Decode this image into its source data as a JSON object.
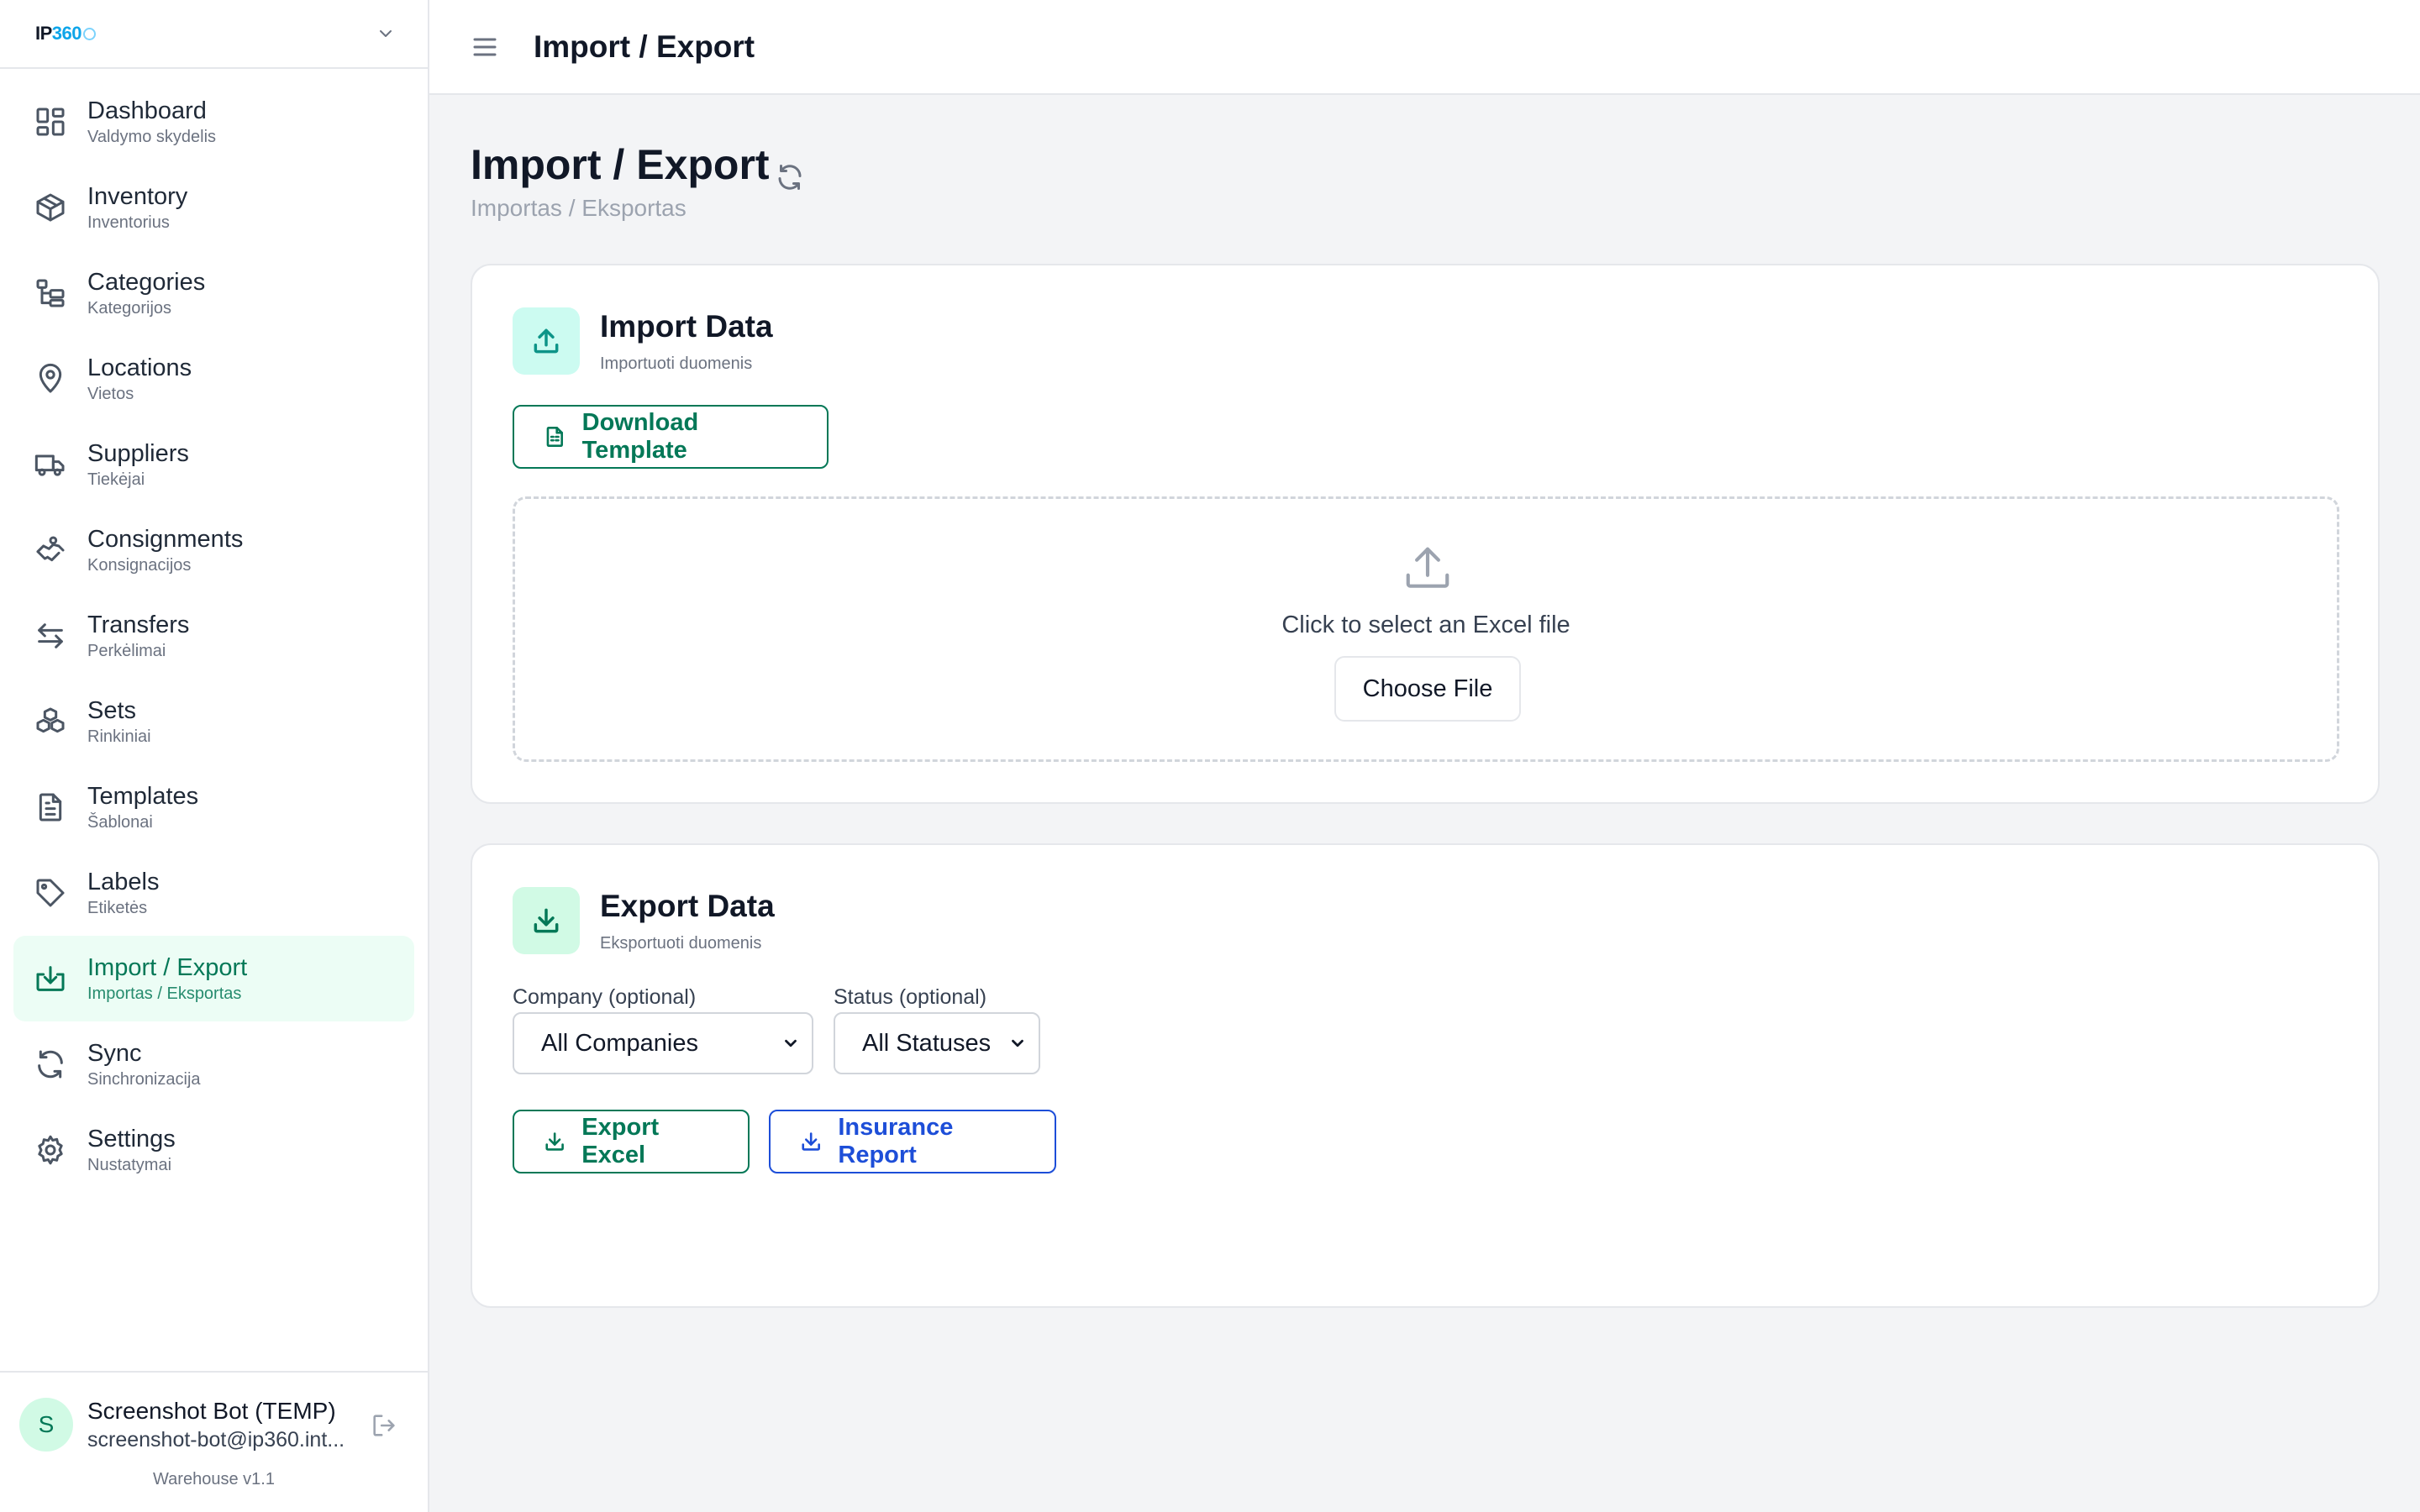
{
  "brand": {
    "logo_text_a": "IP",
    "logo_text_b": "360"
  },
  "sidebar": {
    "items": [
      {
        "label": "Dashboard",
        "sub": "Valdymo skydelis",
        "icon": "dashboard-grid-icon"
      },
      {
        "label": "Inventory",
        "sub": "Inventorius",
        "icon": "box-icon"
      },
      {
        "label": "Categories",
        "sub": "Kategorijos",
        "icon": "hierarchy-icon"
      },
      {
        "label": "Locations",
        "sub": "Vietos",
        "icon": "map-pin-icon"
      },
      {
        "label": "Suppliers",
        "sub": "Tiekėjai",
        "icon": "truck-icon"
      },
      {
        "label": "Consignments",
        "sub": "Konsignacijos",
        "icon": "handshake-icon"
      },
      {
        "label": "Transfers",
        "sub": "Perkėlimai",
        "icon": "arrows-left-right-icon"
      },
      {
        "label": "Sets",
        "sub": "Rinkiniai",
        "icon": "boxes-icon"
      },
      {
        "label": "Templates",
        "sub": "Šablonai",
        "icon": "document-icon"
      },
      {
        "label": "Labels",
        "sub": "Etiketės",
        "icon": "tag-icon"
      },
      {
        "label": "Import / Export",
        "sub": "Importas / Eksportas",
        "icon": "import-export-icon",
        "active": true
      },
      {
        "label": "Sync",
        "sub": "Sinchronizacija",
        "icon": "sync-icon"
      },
      {
        "label": "Settings",
        "sub": "Nustatymai",
        "icon": "gear-icon"
      }
    ]
  },
  "user": {
    "initial": "S",
    "name": "Screenshot Bot (TEMP)",
    "email": "screenshot-bot@ip360.int...",
    "version": "Warehouse v1.1"
  },
  "topbar": {
    "title": "Import / Export"
  },
  "page": {
    "title": "Import / Export",
    "subtitle": "Importas / Eksportas"
  },
  "import_card": {
    "title": "Import Data",
    "subtitle": "Importuoti duomenis",
    "download_template_label": "Download Template",
    "dropzone_text": "Click to select an Excel file",
    "choose_file_label": "Choose File"
  },
  "export_card": {
    "title": "Export Data",
    "subtitle": "Eksportuoti duomenis",
    "company_label": "Company (optional)",
    "company_value": "All Companies",
    "status_label": "Status (optional)",
    "status_value": "All Statuses",
    "export_excel_label": "Export Excel",
    "insurance_report_label": "Insurance Report"
  },
  "colors": {
    "accent_green": "#047857",
    "accent_blue": "#1d4ed8",
    "active_bg": "#ecfdf5",
    "page_bg": "#f3f4f6"
  }
}
